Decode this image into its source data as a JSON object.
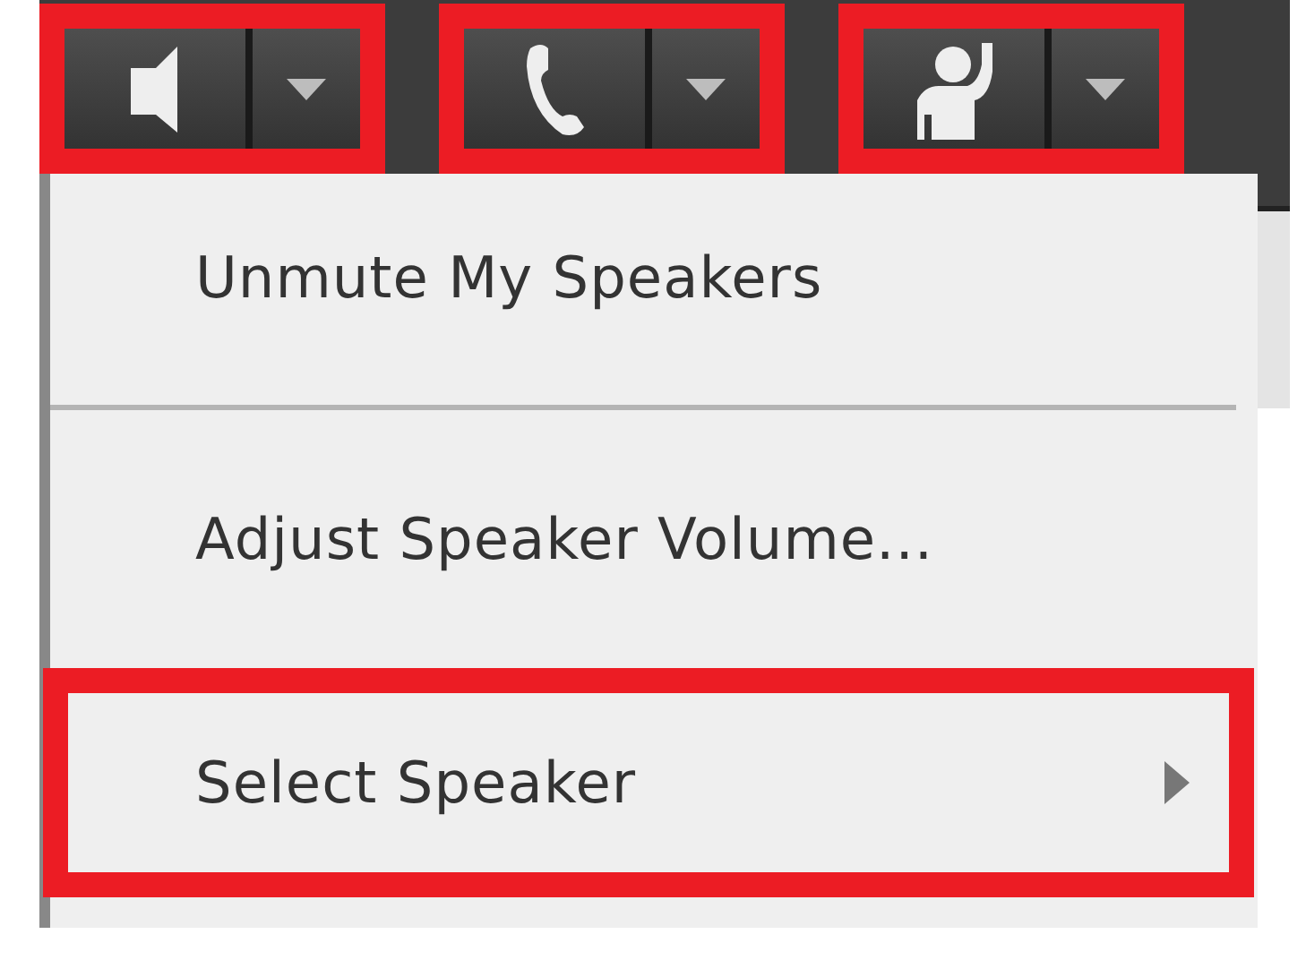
{
  "toolbar": {
    "buttons": [
      {
        "kind": "speaker",
        "highlighted": true
      },
      {
        "kind": "phone",
        "highlighted": true
      },
      {
        "kind": "raised-hand",
        "highlighted": true
      }
    ]
  },
  "menu": {
    "items": [
      {
        "kind": "item",
        "label": "Unmute My Speakers",
        "highlighted": false,
        "submenu": false
      },
      {
        "kind": "separator"
      },
      {
        "kind": "item",
        "label": "Adjust Speaker Volume...",
        "highlighted": false,
        "submenu": false
      },
      {
        "kind": "item",
        "label": "Select Speaker",
        "highlighted": true,
        "submenu": true
      }
    ]
  }
}
